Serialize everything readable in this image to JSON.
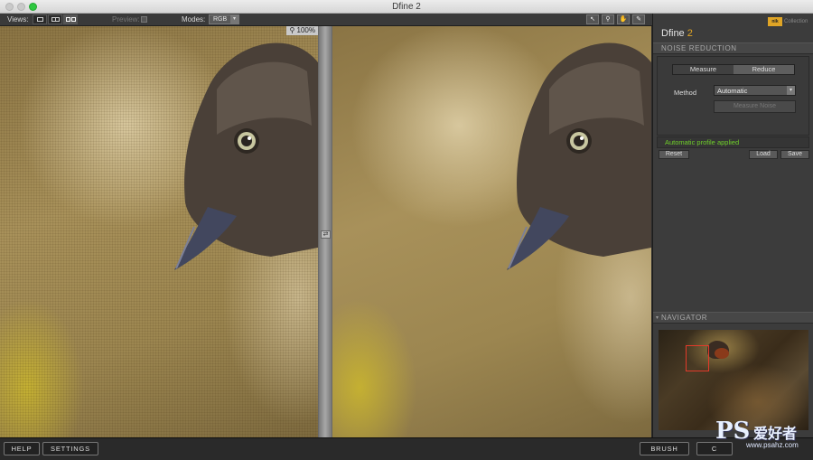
{
  "window": {
    "title": "Dfine 2"
  },
  "toolbar": {
    "views_label": "Views:",
    "preview_label": "Preview:",
    "modes_label": "Modes:",
    "modes_value": "RGB",
    "tools": [
      "pointer-icon",
      "zoom-icon",
      "hand-icon",
      "eyedropper-icon"
    ]
  },
  "image": {
    "zoom_label": "100%"
  },
  "panel": {
    "brand_badge": "nik",
    "brand_collection": "Collection",
    "app_name": "Dfine",
    "app_version": "2",
    "noise_reduction_header": "NOISE REDUCTION",
    "tabs": {
      "measure": "Measure",
      "reduce": "Reduce"
    },
    "method_label": "Method",
    "method_value": "Automatic",
    "measure_noise_label": "Measure Noise",
    "status_text": "Automatic profile applied",
    "reset_label": "Reset",
    "load_label": "Load",
    "save_label": "Save",
    "navigator_header": "NAVIGATOR"
  },
  "bottom": {
    "help_label": "HELP",
    "settings_label": "SETTINGS",
    "brush_label": "BRUSH",
    "cancel_label": "C"
  },
  "watermark": {
    "ps": "PS",
    "cn": "爱好者",
    "url": "www.psahz.com"
  },
  "colors": {
    "accent": "#e0a526",
    "status_green": "#6fcf2a",
    "nav_rect": "#e23a2a"
  }
}
